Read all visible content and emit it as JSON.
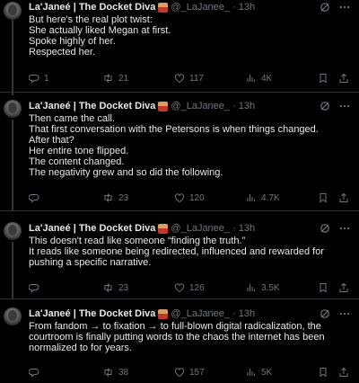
{
  "tweets": [
    {
      "author": {
        "name": "La'Janeé | The Docket Diva",
        "handle": "@_LaJanee_",
        "time": "13h"
      },
      "lines": [
        "But here's the real plot twist:",
        "She actually liked Megan at first.",
        "Spoke highly of her.",
        "Respected her."
      ],
      "stats": {
        "replies": "1",
        "reposts": "21",
        "likes": "117",
        "views": "4K"
      }
    },
    {
      "author": {
        "name": "La'Janeé | The Docket Diva",
        "handle": "@_LaJanee_",
        "time": "13h"
      },
      "lines": [
        "Then came the call.",
        "That first conversation with the Petersons is when things changed.",
        "After that?",
        "Her entire tone flipped.",
        "The content changed.",
        "The negativity grew and so did the following."
      ],
      "stats": {
        "replies": "",
        "reposts": "23",
        "likes": "120",
        "views": "4.7K"
      }
    },
    {
      "author": {
        "name": "La'Janeé | The Docket Diva",
        "handle": "@_LaJanee_",
        "time": "13h"
      },
      "lines": [
        "This doesn't read like someone “finding the truth.”",
        "It reads like someone being redirected, influenced and rewarded for",
        "pushing a specific narrative."
      ],
      "stats": {
        "replies": "",
        "reposts": "23",
        "likes": "126",
        "views": "3.5K"
      }
    },
    {
      "author": {
        "name": "La'Janeé | The Docket Diva",
        "handle": "@_LaJanee_",
        "time": "13h"
      },
      "lines": [
        "From fandom → to fixation → to full-blown digital radicalization, the",
        "courtroom is finally putting words to the chaos the internet has been",
        "normalized to for years."
      ],
      "stats": {
        "replies": "",
        "reposts": "38",
        "likes": "157",
        "views": "5K"
      }
    }
  ],
  "separator_dot": "·",
  "colors": {
    "background": "#000000",
    "text": "#e7e9ea",
    "muted": "#71767b",
    "border": "#2f3336"
  }
}
